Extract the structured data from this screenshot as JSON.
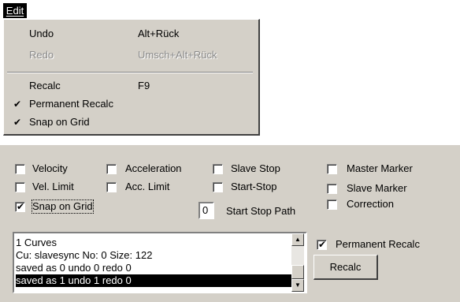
{
  "menubar": {
    "edit_label": "Edit"
  },
  "menu": {
    "undo": {
      "label": "Undo",
      "shortcut": "Alt+Rück"
    },
    "redo": {
      "label": "Redo",
      "shortcut": "Umsch+Alt+Rück"
    },
    "recalc": {
      "label": "Recalc",
      "shortcut": "F9"
    },
    "permanent_recalc": {
      "label": "Permanent Recalc",
      "check": "✔"
    },
    "snap_on_grid": {
      "label": "Snap on Grid",
      "check": "✔"
    }
  },
  "panel": {
    "checkboxes": {
      "velocity": "Velocity",
      "acceleration": "Acceleration",
      "slave_stop": "Slave Stop",
      "master_marker": "Master Marker",
      "vel_limit": "Vel. Limit",
      "acc_limit": "Acc. Limit",
      "start_stop": "Start-Stop",
      "slave_marker": "Slave Marker",
      "snap_on_grid": "Snap on Grid",
      "correction": "Correction",
      "permanent_recalc": "Permanent Recalc",
      "check_mark": "✔"
    },
    "start_stop_path": {
      "value": "0",
      "label": "Start Stop Path"
    },
    "list": {
      "rows": [
        "1 Curves",
        "Cu: slavesync No: 0 Size: 122",
        "saved as 0 undo 0 redo 0",
        "saved as 1 undo 1 redo 0"
      ]
    },
    "recalc_button": "Recalc",
    "scroll": {
      "up": "▲",
      "down": "▼"
    }
  }
}
